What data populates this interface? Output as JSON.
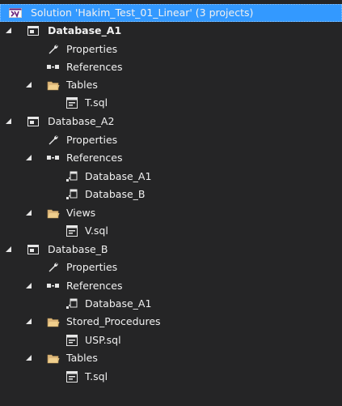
{
  "solution_explorer": {
    "solution": {
      "label": "Solution 'Hakim_Test_01_Linear' (3 projects)",
      "icon": "vs-solution-icon"
    },
    "projects": [
      {
        "name": "Database_A1",
        "icon": "database-project-icon",
        "bold": true,
        "properties_label": "Properties",
        "references": {
          "label": "References",
          "items": []
        },
        "folders": [
          {
            "name": "Tables",
            "icon": "folder-open-icon",
            "files": [
              "T.sql"
            ]
          }
        ]
      },
      {
        "name": "Database_A2",
        "icon": "database-project-icon",
        "bold": false,
        "properties_label": "Properties",
        "references": {
          "label": "References",
          "items": [
            "Database_A1",
            "Database_B"
          ]
        },
        "folders": [
          {
            "name": "Views",
            "icon": "folder-open-icon",
            "files": [
              "V.sql"
            ]
          }
        ]
      },
      {
        "name": "Database_B",
        "icon": "database-project-icon",
        "bold": false,
        "properties_label": "Properties",
        "references": {
          "label": "References",
          "items": [
            "Database_A1"
          ]
        },
        "folders": [
          {
            "name": "Stored_Procedures",
            "icon": "folder-open-icon",
            "files": [
              "USP.sql"
            ]
          },
          {
            "name": "Tables",
            "icon": "folder-open-icon",
            "files": [
              "T.sql"
            ]
          }
        ]
      }
    ]
  },
  "colors": {
    "background": "#252526",
    "selection": "#3399ff",
    "text": "#f1f1f1",
    "folder": "#dcb67a",
    "vs_purple": "#68217a"
  }
}
